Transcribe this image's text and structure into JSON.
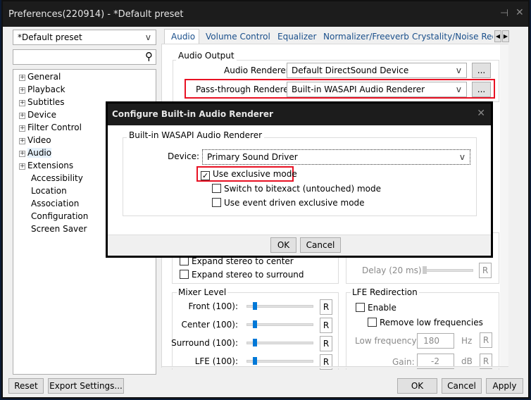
{
  "window": {
    "title": "Preferences(220914) - *Default preset",
    "pin_icon": "pin-icon",
    "close_icon": "close-icon"
  },
  "left": {
    "preset": "*Default preset",
    "search_placeholder": "",
    "tree": [
      {
        "label": "General",
        "expandable": true
      },
      {
        "label": "Playback",
        "expandable": true
      },
      {
        "label": "Subtitles",
        "expandable": true
      },
      {
        "label": "Device",
        "expandable": true
      },
      {
        "label": "Filter Control",
        "expandable": true
      },
      {
        "label": "Video",
        "expandable": true
      },
      {
        "label": "Audio",
        "expandable": true,
        "selected": true
      },
      {
        "label": "Extensions",
        "expandable": true
      },
      {
        "label": "Accessibility"
      },
      {
        "label": "Location"
      },
      {
        "label": "Association"
      },
      {
        "label": "Configuration"
      },
      {
        "label": "Screen Saver"
      }
    ]
  },
  "tabs": [
    "Audio",
    "Volume Control",
    "Equalizer",
    "Normalizer/Freeverb",
    "Crystality/Noise Redu"
  ],
  "audio_output": {
    "group": "Audio Output",
    "renderer_label": "Audio Renderer:",
    "renderer_value": "Default DirectSound Device",
    "passthrough_label": "Pass-through Renderer:",
    "passthrough_value": "Built-in WASAPI Audio Renderer",
    "more": "..."
  },
  "behind": {
    "expand_center": "Expand stereo to center",
    "expand_surround": "Expand stereo to surround",
    "delay": "Delay (20 ms):",
    "mixer": {
      "group": "Mixer Level",
      "rows": [
        {
          "label": "Front (100):",
          "level": 100
        },
        {
          "label": "Center (100):",
          "level": 100
        },
        {
          "label": "Surround (100):",
          "level": 100
        },
        {
          "label": "LFE (100):",
          "level": 100
        }
      ],
      "reset": "R"
    },
    "lfe": {
      "group": "LFE Redirection",
      "enable": "Enable",
      "remove_low": "Remove low frequencies",
      "low_freq_label": "Low frequency:",
      "low_freq_value": "180",
      "low_freq_unit": "Hz",
      "gain_label": "Gain:",
      "gain_value": "-2",
      "gain_unit": "dB"
    }
  },
  "dialog": {
    "title": "Configure Built-in Audio Renderer",
    "group": "Built-in WASAPI Audio Renderer",
    "device_label": "Device:",
    "device_value": "Primary Sound Driver",
    "exclusive": {
      "label": "Use exclusive mode",
      "checked": true
    },
    "bitexact": {
      "label": "Switch to bitexact (untouched) mode",
      "checked": false
    },
    "event_driven": {
      "label": "Use event driven exclusive mode",
      "checked": false
    },
    "ok": "OK",
    "cancel": "Cancel"
  },
  "footer": {
    "reset": "Reset",
    "export": "Export Settings...",
    "ok": "OK",
    "cancel": "Cancel",
    "apply": "Apply"
  },
  "colors": {
    "highlight": "#e81123",
    "accent": "#0078d7"
  }
}
